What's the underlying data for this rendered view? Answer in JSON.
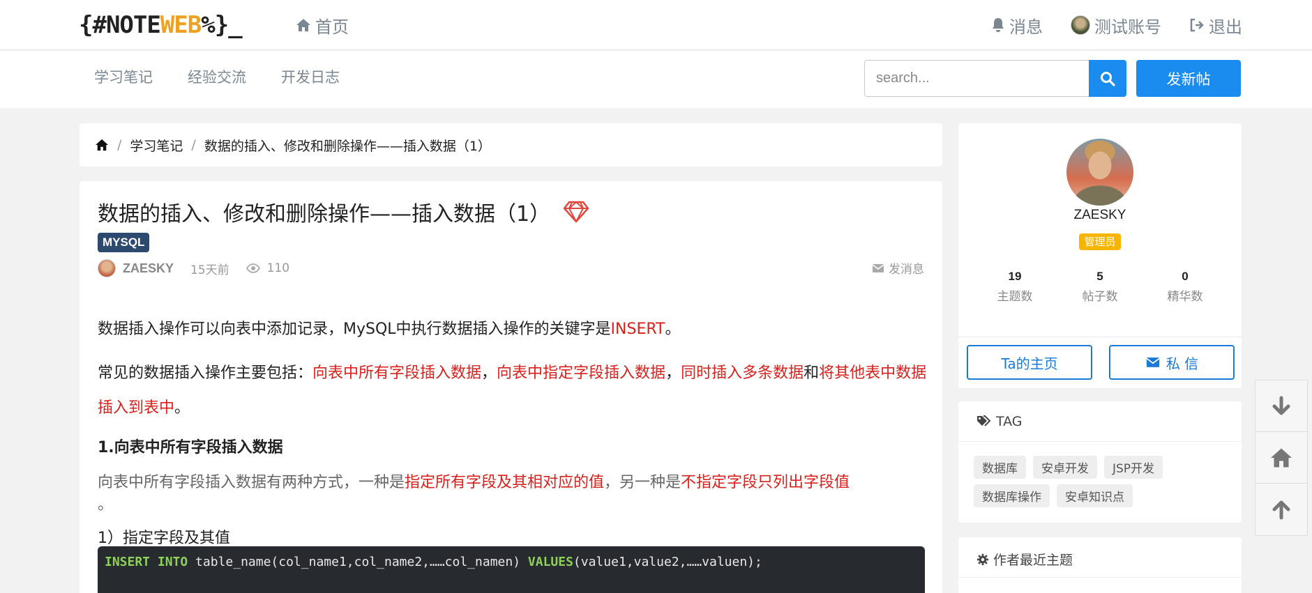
{
  "header": {
    "logo_part1": "{#NOTE",
    "logo_part2": "WEB",
    "logo_part3": "%}_",
    "home_label": "首页",
    "messages_label": "消息",
    "account_label": "测试账号",
    "logout_label": "退出"
  },
  "subnav": {
    "categories": [
      "学习笔记",
      "经验交流",
      "开发日志"
    ],
    "search_placeholder": "search...",
    "new_post_label": "发新帖"
  },
  "breadcrumb": {
    "category": "学习笔记",
    "current": "数据的插入、修改和删除操作——插入数据（1）",
    "separator": "/"
  },
  "article": {
    "title": "数据的插入、修改和删除操作——插入数据（1）",
    "tag": "MYSQL",
    "author": "ZAESKY",
    "time": "15天前",
    "views": "110",
    "send_message": "发消息",
    "p1_a": "数据插入操作可以向表中添加记录，MySQL中执行数据插入操作的关键字是",
    "p1_red": "INSERT",
    "p1_b": "。",
    "p2_a": "常见的数据插入操作主要包括：",
    "p2_r1": "向表中所有字段插入数据",
    "p2_c1": "，",
    "p2_r2": "向表中指定字段插入数据",
    "p2_c2": "，",
    "p2_r3": "同时插入多条数据",
    "p2_and": "和",
    "p2_r4": "将其他表中数据插入到表中",
    "p2_end": "。",
    "h3": "1.向表中所有字段插入数据",
    "p3_a": "向表中所有字段插入数据有两种方式，一种是",
    "p3_r1": "指定所有字段及其相对应的值",
    "p3_b": "，另一种是",
    "p3_r2": "不指定字段只列出字段值",
    "p3_dot": "。",
    "p4": "1）指定字段及其值",
    "code_kw1": "INSERT INTO",
    "code_mid": " table_name(col_name1,col_name2,……col_namen) ",
    "code_kw2": "VALUES",
    "code_end": "(value1,value2,……valuen);"
  },
  "profile": {
    "name": "ZAESKY",
    "role": "管理员",
    "stats": [
      {
        "value": "19",
        "label": "主题数"
      },
      {
        "value": "5",
        "label": "帖子数"
      },
      {
        "value": "0",
        "label": "精华数"
      }
    ],
    "home_button": "Ta的主页",
    "pm_button": "私 信"
  },
  "tag_card": {
    "title": "TAG",
    "tags": [
      "数据库",
      "安卓开发",
      "JSP开发",
      "数据库操作",
      "安卓知识点"
    ]
  },
  "recent_card": {
    "title": "作者最近主题"
  },
  "colors": {
    "primary": "#1a8cf0",
    "accent_red": "#d9201c",
    "badge_blue": "#2d4a6e",
    "admin_yellow": "#f7b500"
  }
}
